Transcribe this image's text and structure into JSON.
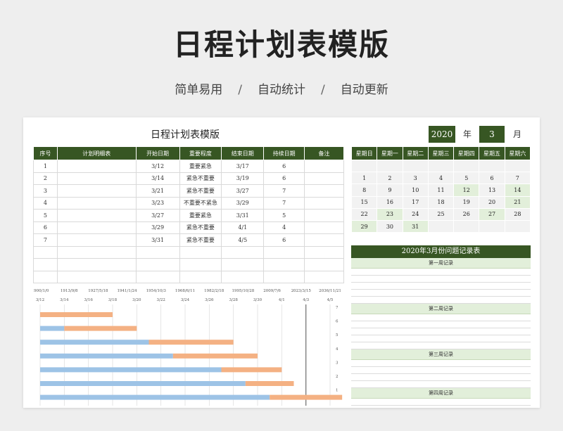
{
  "hero": {
    "title": "日程计划表模版",
    "sub": [
      "简单易用",
      "自动统计",
      "自动更新"
    ],
    "sep": "/"
  },
  "sheet": {
    "title": "日程计划表模版",
    "year": "2020",
    "year_label": "年",
    "month": "3",
    "month_label": "月"
  },
  "schedule": {
    "headers": [
      "序号",
      "计划明细表",
      "开始日期",
      "重要程度",
      "结束日期",
      "持续日期",
      "备注"
    ],
    "rows": [
      {
        "no": "1",
        "detail": "",
        "start": "3/12",
        "level": "重要紧急",
        "level_class": "lvl-red",
        "end": "3/17",
        "dur": "6",
        "note": ""
      },
      {
        "no": "2",
        "detail": "",
        "start": "3/14",
        "level": "紧急不重要",
        "level_class": "lvl-yellow",
        "end": "3/19",
        "dur": "6",
        "note": ""
      },
      {
        "no": "3",
        "detail": "",
        "start": "3/21",
        "level": "紧急不重要",
        "level_class": "lvl-yellow",
        "end": "3/27",
        "dur": "7",
        "note": ""
      },
      {
        "no": "4",
        "detail": "",
        "start": "3/23",
        "level": "不重要不紧急",
        "level_class": "lvl-green",
        "end": "3/29",
        "dur": "7",
        "note": ""
      },
      {
        "no": "5",
        "detail": "",
        "start": "3/27",
        "level": "重要紧急",
        "level_class": "lvl-red",
        "end": "3/31",
        "dur": "5",
        "note": ""
      },
      {
        "no": "6",
        "detail": "",
        "start": "3/29",
        "level": "紧急不重要",
        "level_class": "lvl-yellow",
        "end": "4/1",
        "dur": "4",
        "note": ""
      },
      {
        "no": "7",
        "detail": "",
        "start": "3/31",
        "level": "紧急不重要",
        "level_class": "lvl-yellow",
        "end": "4/5",
        "dur": "6",
        "note": ""
      }
    ],
    "empty_rows": 3
  },
  "calendar": {
    "headers": [
      "星期日",
      "星期一",
      "星期二",
      "星期三",
      "星期四",
      "星期五",
      "星期六"
    ],
    "weeks": [
      [
        "",
        "",
        "",
        "",
        "",
        "",
        ""
      ],
      [
        "1",
        "2",
        "3",
        "4",
        "5",
        "6",
        "7"
      ],
      [
        "8",
        "9",
        "10",
        "11",
        "12",
        "13",
        "14"
      ],
      [
        "15",
        "16",
        "17",
        "18",
        "19",
        "20",
        "21"
      ],
      [
        "22",
        "23",
        "24",
        "25",
        "26",
        "27",
        "28"
      ],
      [
        "29",
        "30",
        "31",
        "",
        "",
        "",
        ""
      ]
    ],
    "highlighted": [
      "12",
      "14",
      "21",
      "23",
      "27",
      "29",
      "31"
    ]
  },
  "issues": {
    "title": "2020年3月份问题记录表",
    "weeks": [
      "第一周记录",
      "第二周记录",
      "第三周记录",
      "第四周记录"
    ]
  },
  "chart_data": {
    "type": "bar",
    "orientation": "horizontal-stacked",
    "top_axis_labels": [
      "1900/1/0",
      "1913/9/8",
      "1927/5/18",
      "1941/1/24",
      "1954/10/3",
      "1968/6/11",
      "1982/2/18",
      "1995/10/28",
      "2009/7/6",
      "2023/3/15",
      "2036/11/21"
    ],
    "bottom_axis_labels": [
      "3/12",
      "3/14",
      "3/16",
      "3/18",
      "3/20",
      "3/22",
      "3/24",
      "3/26",
      "3/28",
      "3/30",
      "4/1",
      "4/3",
      "4/5"
    ],
    "categories": [
      "7",
      "6",
      "5",
      "4",
      "3",
      "2",
      "1"
    ],
    "x_start": "3/12",
    "x_end": "4/5",
    "series": [
      {
        "color": "#9dc3e6",
        "values": [
          0,
          2,
          9,
          11,
          15,
          17,
          19
        ]
      },
      {
        "color": "#f4b183",
        "values": [
          6,
          6,
          7,
          7,
          5,
          4,
          6
        ]
      }
    ],
    "today_marker": "4/3"
  }
}
